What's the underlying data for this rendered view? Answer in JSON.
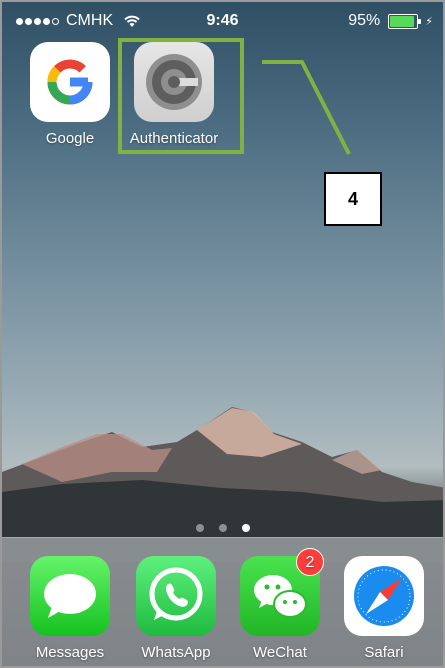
{
  "status_bar": {
    "carrier": "CMHK",
    "time": "9:46",
    "battery_percent": "95%",
    "battery_level": 0.95,
    "battery_color": "#59d95a",
    "signal_bars_filled": 4,
    "signal_bars_total": 5
  },
  "home": {
    "apps": [
      {
        "label": "Google",
        "icon": "google-g-icon"
      },
      {
        "label": "Authenticator",
        "icon": "authenticator-icon"
      }
    ]
  },
  "annotation": {
    "callout_number": "4",
    "highlight_color": "#7fb241"
  },
  "page_indicator": {
    "pages": 3,
    "active_index": 2
  },
  "dock": {
    "apps": [
      {
        "label": "Messages",
        "icon": "speech-bubble-icon"
      },
      {
        "label": "WhatsApp",
        "icon": "phone-bubble-icon"
      },
      {
        "label": "WeChat",
        "icon": "chat-bubbles-icon",
        "badge": "2"
      },
      {
        "label": "Safari",
        "icon": "compass-icon"
      }
    ]
  }
}
